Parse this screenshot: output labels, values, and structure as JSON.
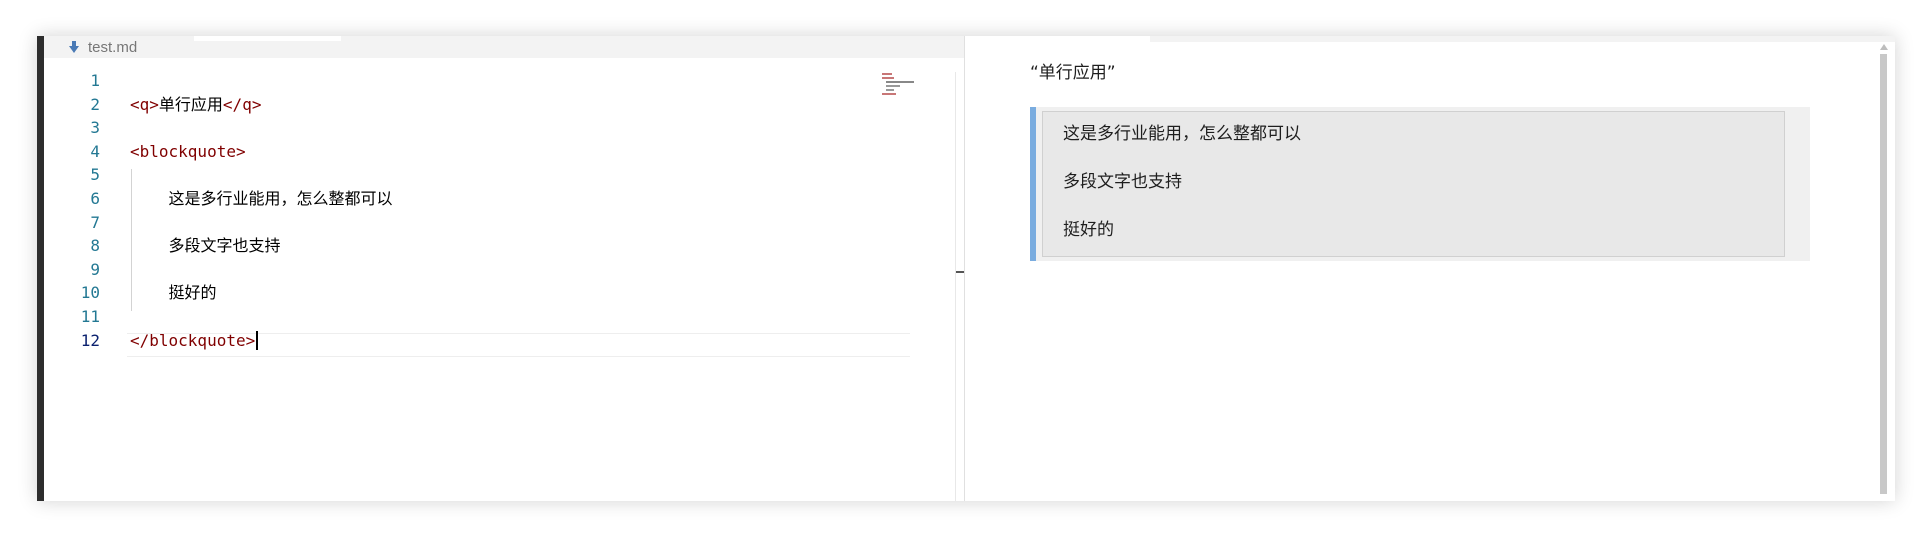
{
  "editor": {
    "tab": {
      "filename": "test.md",
      "icon": "markdown-arrow-icon"
    },
    "lines": [
      {
        "number": "1",
        "parts": []
      },
      {
        "number": "2",
        "parts": [
          {
            "t": "tag",
            "v": "<q>"
          },
          {
            "t": "text",
            "v": "单行应用"
          },
          {
            "t": "tag",
            "v": "</q>"
          }
        ]
      },
      {
        "number": "3",
        "parts": []
      },
      {
        "number": "4",
        "parts": [
          {
            "t": "tag",
            "v": "<blockquote>"
          }
        ]
      },
      {
        "number": "5",
        "parts": []
      },
      {
        "number": "6",
        "parts": [
          {
            "t": "text",
            "v": "    这是多行业能用，怎么整都可以"
          }
        ]
      },
      {
        "number": "7",
        "parts": []
      },
      {
        "number": "8",
        "parts": [
          {
            "t": "text",
            "v": "    多段文字也支持"
          }
        ]
      },
      {
        "number": "9",
        "parts": []
      },
      {
        "number": "10",
        "parts": [
          {
            "t": "text",
            "v": "    挺好的"
          }
        ]
      },
      {
        "number": "11",
        "parts": []
      },
      {
        "number": "12",
        "parts": [
          {
            "t": "tag",
            "v": "</blockquote>"
          }
        ]
      }
    ],
    "active_line": "12"
  },
  "preview": {
    "inline_quote": "“单行应用”",
    "blockquote_paragraphs": [
      "这是多行业能用，怎么整都可以",
      "多段文字也支持",
      "挺好的"
    ]
  },
  "colors": {
    "tag": "#800000",
    "line_number": "#237893",
    "blockquote_border": "#7aacdf"
  }
}
